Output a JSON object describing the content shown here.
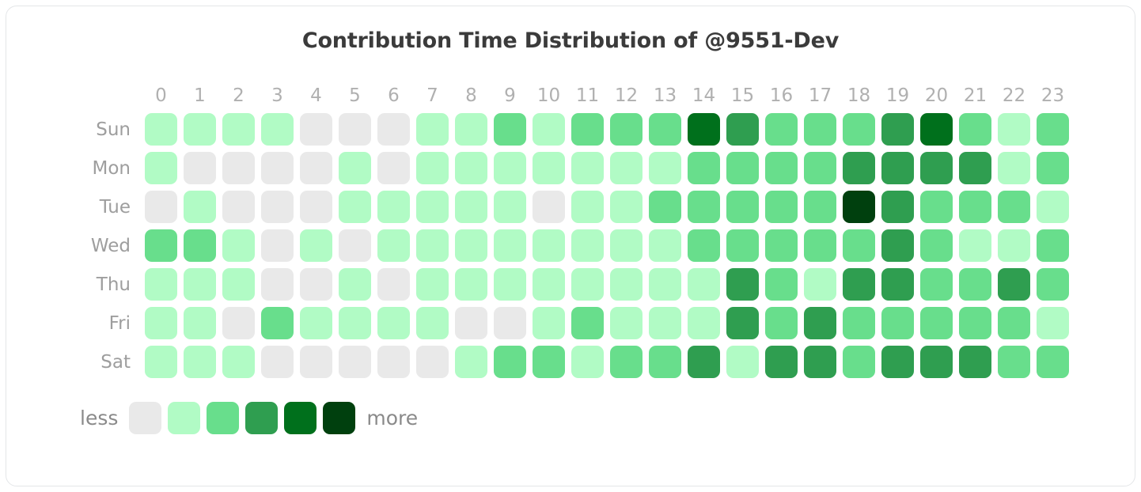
{
  "card": {
    "title": "Contribution Time Distribution of @9551-Dev"
  },
  "legend": {
    "less_label": "less",
    "more_label": "more"
  },
  "colors": {
    "level_0": "#e9e9e9",
    "level_1": "#b1fbc5",
    "level_2": "#68de8c",
    "level_3": "#2f9e50",
    "level_4": "#00701c",
    "level_5": "#00400e",
    "title_text": "#3b3b3b",
    "axis_text": "#b0b0b0",
    "day_text": "#9e9e9e",
    "legend_text": "#8a8a8a",
    "card_border": "#e4e6e8",
    "background": "#ffffff"
  },
  "chart_data": {
    "type": "heatmap",
    "title": "Contribution Time Distribution of @9551-Dev",
    "xlabel": "",
    "ylabel": "",
    "x": [
      "0",
      "1",
      "2",
      "3",
      "4",
      "5",
      "6",
      "7",
      "8",
      "9",
      "10",
      "11",
      "12",
      "13",
      "14",
      "15",
      "16",
      "17",
      "18",
      "19",
      "20",
      "21",
      "22",
      "23"
    ],
    "y": [
      "Sun",
      "Mon",
      "Tue",
      "Wed",
      "Thu",
      "Fri",
      "Sat"
    ],
    "legend_position": "bottom-left",
    "grid": false,
    "color_scale": [
      "#e9e9e9",
      "#b1fbc5",
      "#68de8c",
      "#2f9e50",
      "#00701c",
      "#00400e"
    ],
    "levels_min": 0,
    "levels_max": 5,
    "values": [
      [
        1,
        1,
        1,
        1,
        0,
        0,
        0,
        1,
        1,
        2,
        1,
        2,
        2,
        2,
        4,
        3,
        2,
        2,
        2,
        3,
        4,
        2,
        1,
        2
      ],
      [
        1,
        0,
        0,
        0,
        0,
        1,
        0,
        1,
        1,
        1,
        1,
        1,
        1,
        1,
        2,
        2,
        2,
        2,
        3,
        3,
        3,
        3,
        1,
        2
      ],
      [
        0,
        1,
        0,
        0,
        0,
        1,
        1,
        1,
        1,
        1,
        0,
        1,
        1,
        2,
        2,
        2,
        2,
        2,
        5,
        3,
        2,
        2,
        2,
        1
      ],
      [
        2,
        2,
        1,
        0,
        1,
        0,
        1,
        1,
        1,
        1,
        1,
        1,
        1,
        1,
        2,
        2,
        2,
        2,
        2,
        3,
        2,
        1,
        1,
        2
      ],
      [
        1,
        1,
        1,
        0,
        0,
        1,
        0,
        1,
        1,
        1,
        1,
        1,
        1,
        1,
        1,
        3,
        2,
        1,
        3,
        3,
        2,
        2,
        3,
        2
      ],
      [
        1,
        1,
        0,
        2,
        1,
        1,
        1,
        1,
        0,
        0,
        1,
        2,
        1,
        1,
        1,
        3,
        2,
        3,
        2,
        2,
        2,
        2,
        2,
        1
      ],
      [
        1,
        1,
        1,
        0,
        0,
        0,
        0,
        0,
        1,
        2,
        2,
        1,
        2,
        2,
        3,
        1,
        3,
        3,
        2,
        3,
        3,
        3,
        2,
        2
      ]
    ]
  }
}
